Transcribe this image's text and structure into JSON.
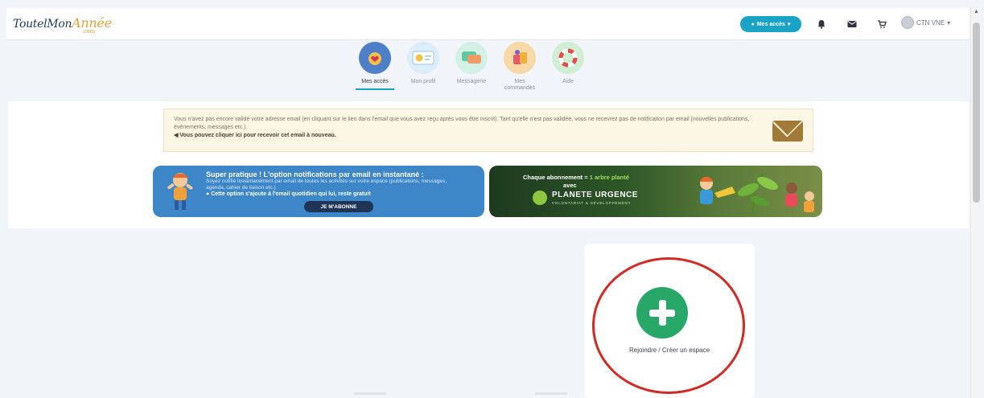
{
  "header": {
    "logo_main": "ToutelMon",
    "logo_accent": "Année",
    "logo_suffix": ".com",
    "access_button": "Mes accès",
    "user_name": "CTN VNE"
  },
  "nav": {
    "items": [
      {
        "label": "Mes accès",
        "active": true
      },
      {
        "label": "Mon profil",
        "active": false
      },
      {
        "label": "Messagerie",
        "active": false
      },
      {
        "label": "Mes commandes",
        "active": false
      },
      {
        "label": "Aide",
        "active": false
      }
    ]
  },
  "alert": {
    "text": "Vous n'avez pas encore validé votre adresse email (en cliquant sur le lien dans l'email que vous avez reçu après vous être inscrit). Tant qu'elle n'est pas validée, vous ne recevrez pas de notification par email (nouvelles publications, événements, messages etc.).",
    "cta": "Vous pouvez cliquer ici pour recevoir cet email à nouveau."
  },
  "banner_left": {
    "title": "Super pratique ! L'option notifications par email en instantané :",
    "subtitle": "Soyez notifié instantanément par email de toutes les activités sur votre espace (publications, messages, agenda, cahier de liaison etc.)",
    "note": "Cette option s'ajoute à l'email quotidien qui lui, reste gratuit",
    "button": "JE M'ABONNE"
  },
  "banner_right": {
    "line1_prefix": "Chaque abonnement =",
    "line1_highlight": "1 arbre planté",
    "line2": "avec",
    "brand": "PLANETE URGENCE",
    "brand_sub": "VOLONTARIAT & DÉVELOPPEMENT"
  },
  "card": {
    "label": "Rejoindre / Créer un espace"
  },
  "colors": {
    "accent": "#19a3c6",
    "green": "#27a869",
    "annotation": "#d32a24"
  }
}
